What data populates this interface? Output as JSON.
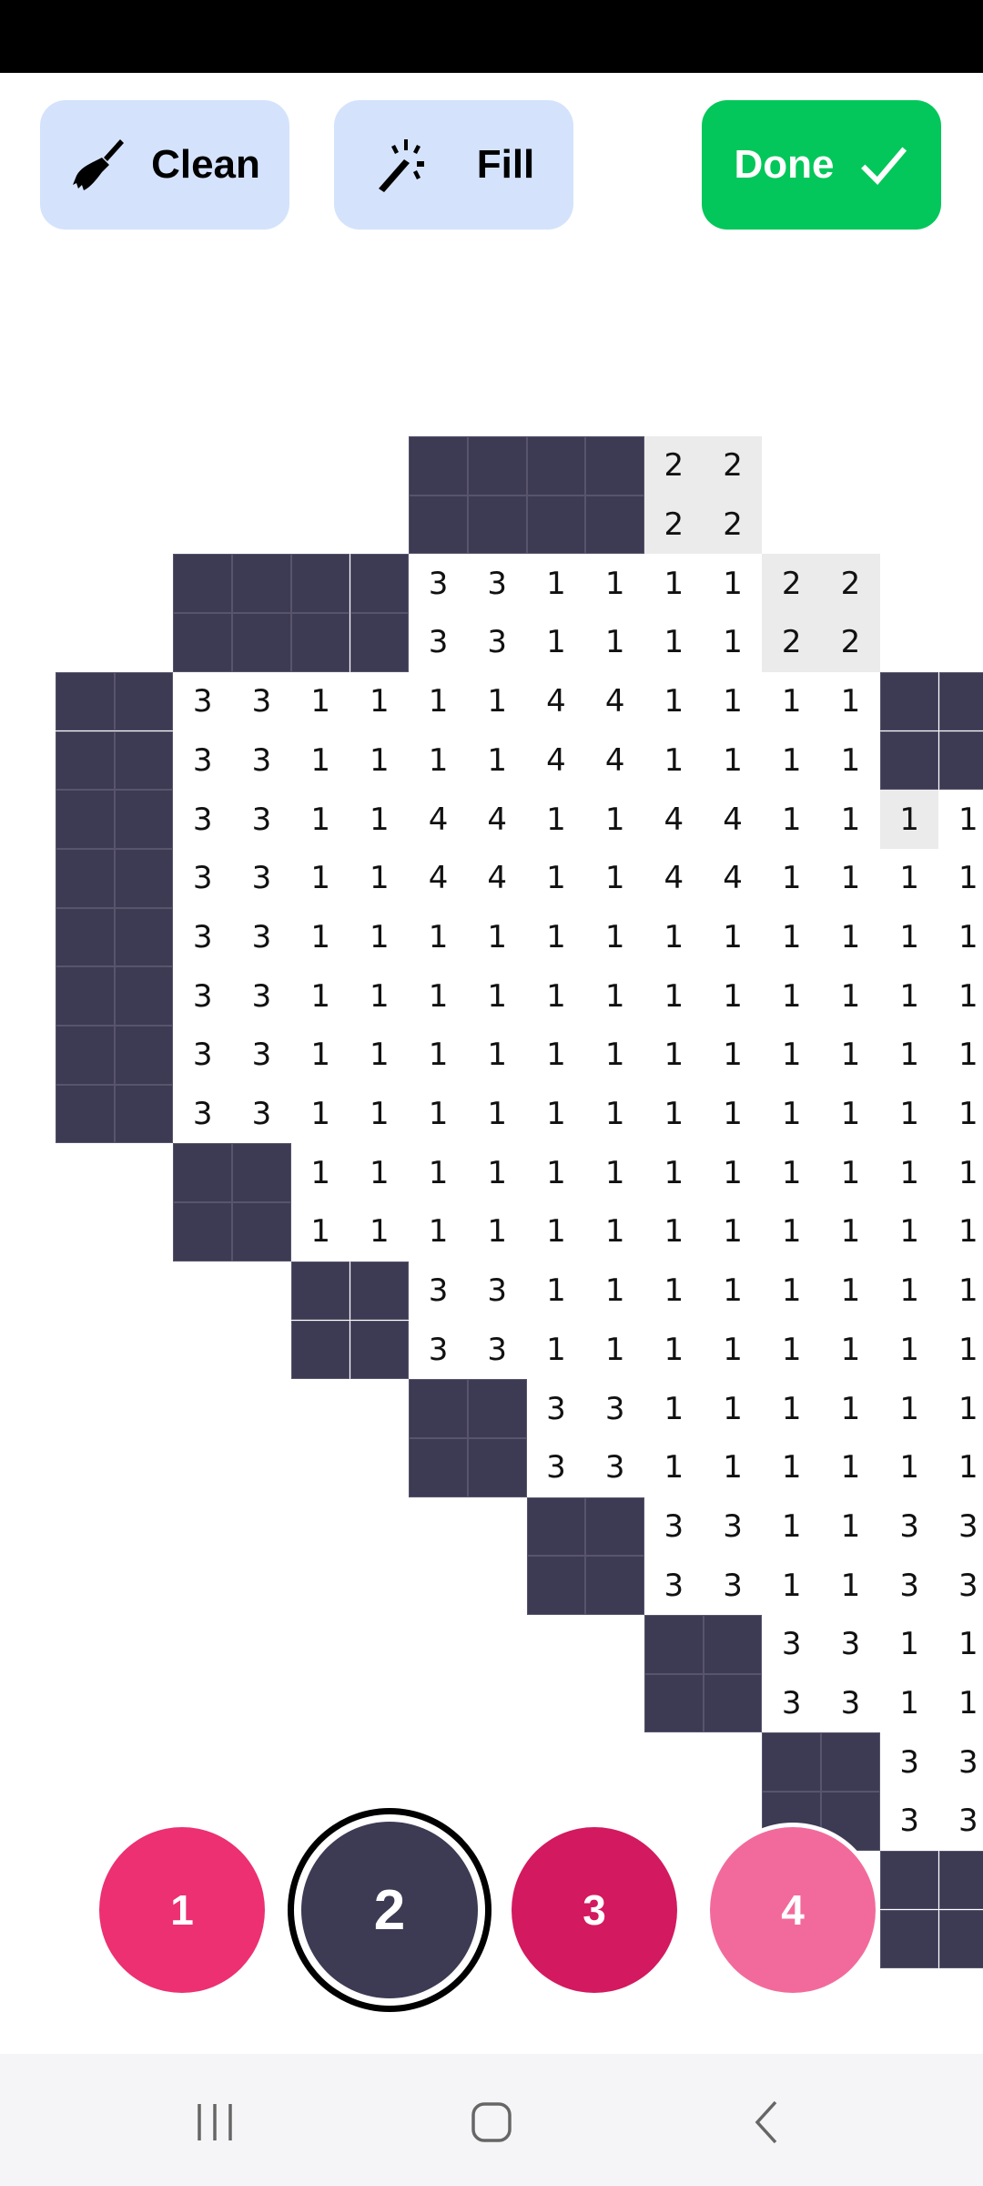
{
  "toolbar": {
    "clean_label": "Clean",
    "fill_label": "Fill",
    "done_label": "Done",
    "clean_icon": "broom-icon",
    "fill_icon": "magic-wand-icon",
    "done_icon": "checkmark-icon"
  },
  "colors": {
    "dark_cell": "#3d3a54",
    "highlight_cell": "#ebebeb",
    "done": "#03c75a",
    "tool_bg": "#d4e3fb"
  },
  "grid": {
    "legend": "D = painted (color 2), G<n> = highlighted number cell, '' = empty",
    "rows": [
      [
        "",
        "",
        "",
        "",
        "",
        "",
        "D",
        "D",
        "D",
        "D",
        "G2",
        "G2",
        "",
        "",
        "",
        ""
      ],
      [
        "",
        "",
        "",
        "",
        "",
        "",
        "D",
        "D",
        "D",
        "D",
        "G2",
        "G2",
        "",
        "",
        "",
        ""
      ],
      [
        "",
        "",
        "D",
        "D",
        "D",
        "D",
        "3",
        "3",
        "1",
        "1",
        "1",
        "1",
        "G2",
        "G2",
        "",
        ""
      ],
      [
        "",
        "",
        "D",
        "D",
        "D",
        "D",
        "3",
        "3",
        "1",
        "1",
        "1",
        "1",
        "G2",
        "G2",
        "",
        ""
      ],
      [
        "D",
        "D",
        "3",
        "3",
        "1",
        "1",
        "1",
        "1",
        "4",
        "4",
        "1",
        "1",
        "1",
        "1",
        "D",
        "D"
      ],
      [
        "D",
        "D",
        "3",
        "3",
        "1",
        "1",
        "1",
        "1",
        "4",
        "4",
        "1",
        "1",
        "1",
        "1",
        "D",
        "D"
      ],
      [
        "D",
        "D",
        "3",
        "3",
        "1",
        "1",
        "4",
        "4",
        "1",
        "1",
        "4",
        "4",
        "1",
        "1",
        "G1",
        "1"
      ],
      [
        "D",
        "D",
        "3",
        "3",
        "1",
        "1",
        "4",
        "4",
        "1",
        "1",
        "4",
        "4",
        "1",
        "1",
        "1",
        "1"
      ],
      [
        "D",
        "D",
        "3",
        "3",
        "1",
        "1",
        "1",
        "1",
        "1",
        "1",
        "1",
        "1",
        "1",
        "1",
        "1",
        "1"
      ],
      [
        "D",
        "D",
        "3",
        "3",
        "1",
        "1",
        "1",
        "1",
        "1",
        "1",
        "1",
        "1",
        "1",
        "1",
        "1",
        "1"
      ],
      [
        "D",
        "D",
        "3",
        "3",
        "1",
        "1",
        "1",
        "1",
        "1",
        "1",
        "1",
        "1",
        "1",
        "1",
        "1",
        "1"
      ],
      [
        "D",
        "D",
        "3",
        "3",
        "1",
        "1",
        "1",
        "1",
        "1",
        "1",
        "1",
        "1",
        "1",
        "1",
        "1",
        "1"
      ],
      [
        "",
        "",
        "D",
        "D",
        "1",
        "1",
        "1",
        "1",
        "1",
        "1",
        "1",
        "1",
        "1",
        "1",
        "1",
        "1"
      ],
      [
        "",
        "",
        "D",
        "D",
        "1",
        "1",
        "1",
        "1",
        "1",
        "1",
        "1",
        "1",
        "1",
        "1",
        "1",
        "1"
      ],
      [
        "",
        "",
        "",
        "",
        "D",
        "D",
        "3",
        "3",
        "1",
        "1",
        "1",
        "1",
        "1",
        "1",
        "1",
        "1"
      ],
      [
        "",
        "",
        "",
        "",
        "D",
        "D",
        "3",
        "3",
        "1",
        "1",
        "1",
        "1",
        "1",
        "1",
        "1",
        "1"
      ],
      [
        "",
        "",
        "",
        "",
        "",
        "",
        "D",
        "D",
        "3",
        "3",
        "1",
        "1",
        "1",
        "1",
        "1",
        "1"
      ],
      [
        "",
        "",
        "",
        "",
        "",
        "",
        "D",
        "D",
        "3",
        "3",
        "1",
        "1",
        "1",
        "1",
        "1",
        "1"
      ],
      [
        "",
        "",
        "",
        "",
        "",
        "",
        "",
        "",
        "D",
        "D",
        "3",
        "3",
        "1",
        "1",
        "3",
        "3"
      ],
      [
        "",
        "",
        "",
        "",
        "",
        "",
        "",
        "",
        "D",
        "D",
        "3",
        "3",
        "1",
        "1",
        "3",
        "3"
      ],
      [
        "",
        "",
        "",
        "",
        "",
        "",
        "",
        "",
        "",
        "",
        "D",
        "D",
        "3",
        "3",
        "1",
        "1"
      ],
      [
        "",
        "",
        "",
        "",
        "",
        "",
        "",
        "",
        "",
        "",
        "D",
        "D",
        "3",
        "3",
        "1",
        "1"
      ],
      [
        "",
        "",
        "",
        "",
        "",
        "",
        "",
        "",
        "",
        "",
        "",
        "",
        "D",
        "D",
        "3",
        "3"
      ],
      [
        "",
        "",
        "",
        "",
        "",
        "",
        "",
        "",
        "",
        "",
        "",
        "",
        "D",
        "D",
        "3",
        "3"
      ],
      [
        "",
        "",
        "",
        "",
        "",
        "",
        "",
        "",
        "",
        "",
        "",
        "",
        "",
        "",
        "D",
        "D"
      ],
      [
        "",
        "",
        "",
        "",
        "",
        "",
        "",
        "",
        "",
        "",
        "",
        "",
        "",
        "",
        "D",
        "D"
      ]
    ]
  },
  "palette": [
    {
      "label": "1",
      "color": "#ec3072",
      "selected": false
    },
    {
      "label": "2",
      "color": "#3d3a54",
      "selected": true
    },
    {
      "label": "3",
      "color": "#d3195f",
      "selected": false
    },
    {
      "label": "4",
      "color": "#f26a9b",
      "selected": false
    }
  ],
  "navbar": {
    "recents_icon": "recents-icon",
    "home_icon": "home-icon",
    "back_icon": "back-icon"
  }
}
